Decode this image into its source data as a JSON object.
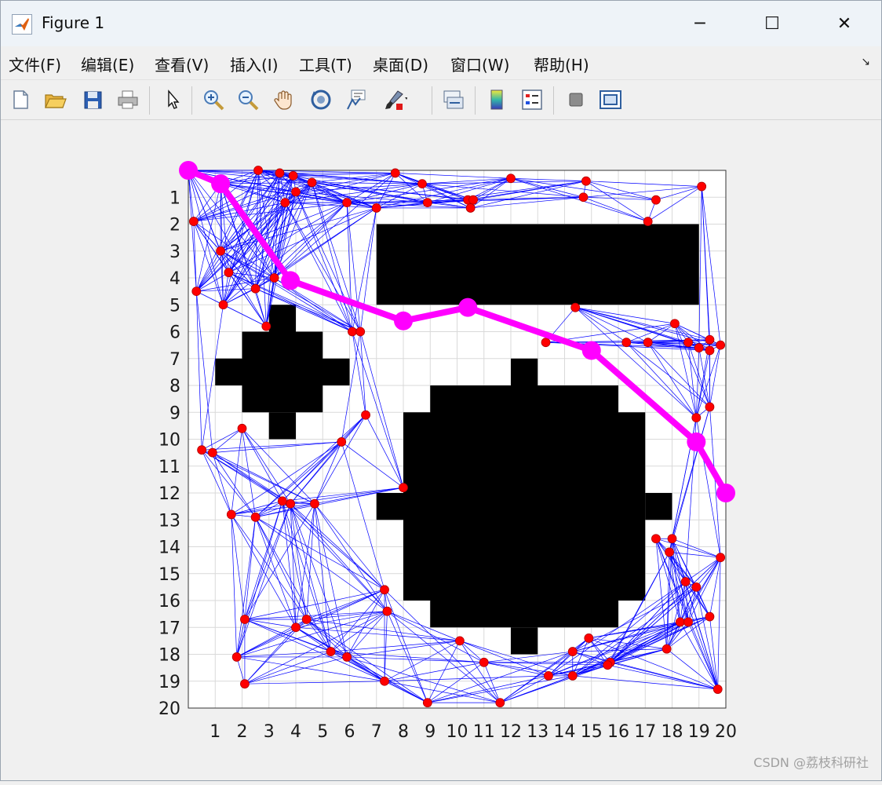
{
  "window": {
    "title": "Figure 1",
    "controls": [
      "─",
      "☐",
      "✕"
    ]
  },
  "menu": [
    "文件(F)",
    "编辑(E)",
    "查看(V)",
    "插入(I)",
    "工具(T)",
    "桌面(D)",
    "窗口(W)",
    "帮助(H)"
  ],
  "toolbar": {
    "buttons": [
      "new-figure-icon",
      "open-file-icon",
      "save-icon",
      "print-icon",
      "pointer-icon",
      "zoom-in-icon",
      "zoom-out-icon",
      "pan-hand-icon",
      "rotate-3d-icon",
      "data-cursor-icon",
      "brush-icon",
      "link-plot-icon",
      "colorbar-icon",
      "legend-icon",
      "hide-plot-tools-icon",
      "show-plot-tools-icon"
    ]
  },
  "colors": {
    "obstacle": "#000000",
    "grid": "#d9d9d9",
    "edge": "#0000ff",
    "node": "#ff0000",
    "path": "#ff00ff"
  },
  "chart_data": {
    "type": "scatter",
    "description_kind": "occupancy grid with probabilistic roadmap and shortest path",
    "xlim": [
      0,
      20
    ],
    "ylim": [
      0,
      20
    ],
    "y_reversed": true,
    "x_ticks": [
      "1",
      "2",
      "3",
      "4",
      "5",
      "6",
      "7",
      "8",
      "9",
      "10",
      "11",
      "12",
      "13",
      "14",
      "15",
      "16",
      "17",
      "18",
      "19",
      "20"
    ],
    "y_ticks": [
      "1",
      "2",
      "3",
      "4",
      "5",
      "6",
      "7",
      "8",
      "9",
      "10",
      "11",
      "12",
      "13",
      "14",
      "15",
      "16",
      "17",
      "18",
      "19",
      "20"
    ],
    "grid": true,
    "obstacles": [
      {
        "x": [
          7,
          19
        ],
        "y": [
          2,
          5
        ]
      },
      {
        "x": [
          3,
          4
        ],
        "y": [
          5,
          6
        ]
      },
      {
        "x": [
          2,
          5
        ],
        "y": [
          6,
          9
        ]
      },
      {
        "x": [
          1,
          6
        ],
        "y": [
          7,
          8
        ]
      },
      {
        "x": [
          3,
          4
        ],
        "y": [
          9,
          10
        ]
      },
      {
        "x": [
          12,
          13
        ],
        "y": [
          7,
          8
        ]
      },
      {
        "x": [
          9,
          16
        ],
        "y": [
          8,
          17
        ]
      },
      {
        "x": [
          8,
          17
        ],
        "y": [
          9,
          16
        ]
      },
      {
        "x": [
          7,
          8
        ],
        "y": [
          12,
          13
        ]
      },
      {
        "x": [
          17,
          18
        ],
        "y": [
          12,
          13
        ]
      },
      {
        "x": [
          12,
          13
        ],
        "y": [
          17,
          18
        ]
      }
    ],
    "nodes": [
      [
        0,
        0
      ],
      [
        1.2,
        0.5
      ],
      [
        2.6,
        0
      ],
      [
        3.4,
        0.1
      ],
      [
        3.9,
        0.2
      ],
      [
        4.6,
        0.45
      ],
      [
        4.0,
        0.8
      ],
      [
        3.6,
        1.2
      ],
      [
        5.9,
        1.2
      ],
      [
        7.0,
        1.4
      ],
      [
        7.7,
        0.1
      ],
      [
        8.7,
        0.5
      ],
      [
        8.9,
        1.2
      ],
      [
        10.4,
        1.1
      ],
      [
        10.6,
        1.1
      ],
      [
        10.5,
        1.4
      ],
      [
        12.0,
        0.3
      ],
      [
        14.8,
        0.4
      ],
      [
        14.7,
        1.0
      ],
      [
        17.4,
        1.1
      ],
      [
        17.1,
        1.9
      ],
      [
        19.1,
        0.6
      ],
      [
        0.2,
        1.9
      ],
      [
        1.2,
        3.0
      ],
      [
        1.5,
        3.8
      ],
      [
        2.5,
        4.4
      ],
      [
        3.2,
        4.0
      ],
      [
        0.3,
        4.5
      ],
      [
        1.3,
        5.0
      ],
      [
        2.9,
        5.8
      ],
      [
        6.1,
        6.0
      ],
      [
        6.4,
        6.0
      ],
      [
        6.6,
        9.1
      ],
      [
        5.7,
        10.1
      ],
      [
        14.4,
        5.1
      ],
      [
        13.3,
        6.4
      ],
      [
        16.3,
        6.4
      ],
      [
        17.1,
        6.4
      ],
      [
        18.1,
        5.7
      ],
      [
        18.6,
        6.4
      ],
      [
        19.0,
        6.6
      ],
      [
        19.4,
        6.7
      ],
      [
        19.8,
        6.5
      ],
      [
        19.4,
        6.3
      ],
      [
        19.4,
        8.8
      ],
      [
        18.9,
        9.2
      ],
      [
        0.5,
        10.4
      ],
      [
        0.9,
        10.5
      ],
      [
        2.0,
        9.6
      ],
      [
        1.6,
        12.8
      ],
      [
        2.5,
        12.9
      ],
      [
        3.5,
        12.3
      ],
      [
        3.8,
        12.4
      ],
      [
        4.7,
        12.4
      ],
      [
        8.0,
        11.8
      ],
      [
        18.0,
        13.7
      ],
      [
        17.4,
        13.7
      ],
      [
        17.9,
        14.2
      ],
      [
        18.5,
        15.3
      ],
      [
        18.9,
        15.5
      ],
      [
        19.8,
        14.4
      ],
      [
        7.3,
        15.6
      ],
      [
        7.4,
        16.4
      ],
      [
        2.1,
        16.7
      ],
      [
        4.0,
        17.0
      ],
      [
        4.4,
        16.7
      ],
      [
        1.8,
        18.1
      ],
      [
        5.3,
        17.9
      ],
      [
        5.9,
        18.1
      ],
      [
        2.1,
        19.1
      ],
      [
        7.3,
        19.0
      ],
      [
        8.9,
        19.8
      ],
      [
        10.1,
        17.5
      ],
      [
        11.0,
        18.3
      ],
      [
        11.6,
        19.8
      ],
      [
        13.4,
        18.8
      ],
      [
        14.3,
        18.8
      ],
      [
        14.3,
        17.9
      ],
      [
        14.9,
        17.4
      ],
      [
        15.7,
        18.3
      ],
      [
        15.6,
        18.4
      ],
      [
        17.8,
        17.8
      ],
      [
        18.3,
        16.8
      ],
      [
        18.6,
        16.8
      ],
      [
        19.4,
        16.6
      ],
      [
        19.7,
        19.3
      ]
    ],
    "path": [
      [
        0,
        0
      ],
      [
        1.2,
        0.5
      ],
      [
        3.8,
        4.1
      ],
      [
        8.0,
        5.6
      ],
      [
        10.4,
        5.1
      ],
      [
        15.0,
        6.7
      ],
      [
        18.9,
        10.1
      ],
      [
        20.0,
        12.0
      ]
    ]
  },
  "watermark": "CSDN @荔枝科研社"
}
